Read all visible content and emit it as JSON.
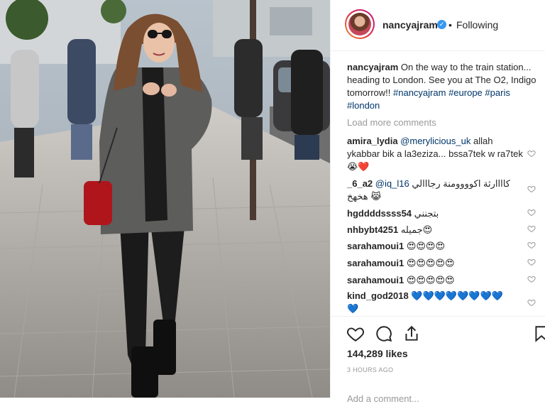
{
  "post": {
    "username": "nancyajram",
    "follow_status": "Following",
    "separator": "•",
    "caption_text": "On the way to the train station... heading to London. See you at The O2, Indigo tomorrow!! ",
    "hashtags": [
      "#nancyajram",
      "#europe",
      "#paris",
      "#london"
    ],
    "load_more": "Load more comments",
    "likes": "144,289 likes",
    "time_ago": "3 HOURS AGO",
    "add_comment_placeholder": "Add a comment..."
  },
  "comments": [
    {
      "user": "amira_lydia",
      "mention": "@merylicious_uk",
      "text": "allah ykabbar bik a la3eziza... bssa7tek w ra7tek",
      "emoji": "😭❤️"
    },
    {
      "user": "_6_a2",
      "mention": "@iq_l16",
      "text": "كاااارثة اكوووومنة رجااالي هخهخ",
      "emoji": "😹"
    },
    {
      "user": "hgddddssss54",
      "mention": "",
      "text": "بتجنني",
      "emoji": ""
    },
    {
      "user": "nhbybt4251",
      "mention": "",
      "text": "جميله",
      "emoji": "😍"
    },
    {
      "user": "sarahamoui1",
      "mention": "",
      "text": "",
      "emoji": "😍😍😍😍"
    },
    {
      "user": "sarahamoui1",
      "mention": "",
      "text": "",
      "emoji": "😍😍😍😍😍"
    },
    {
      "user": "sarahamoui1",
      "mention": "",
      "text": "",
      "emoji": "😍😍😍😍😍"
    },
    {
      "user": "kind_god2018",
      "mention": "",
      "text": "",
      "emoji": "💙💙💙💙💙💙💙💙💙"
    }
  ],
  "icons": {
    "like": "heart-icon",
    "comment": "comment-icon",
    "share": "share-icon",
    "save": "bookmark-icon",
    "verified": "verified-badge-icon"
  },
  "colors": {
    "link": "#003569",
    "muted": "#999999",
    "verified": "#3897f0",
    "text": "#262626"
  }
}
